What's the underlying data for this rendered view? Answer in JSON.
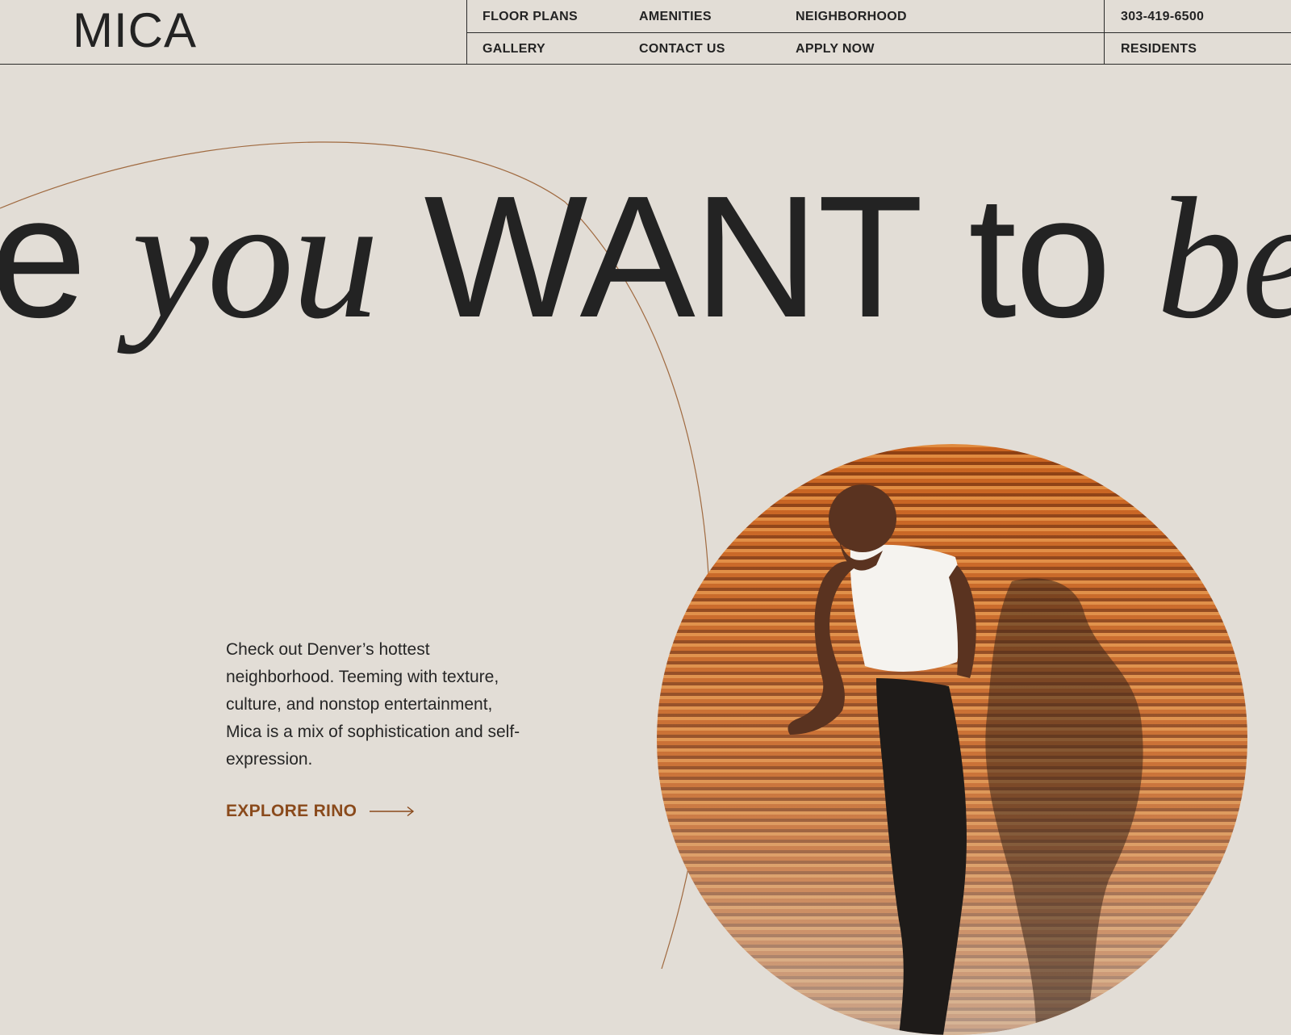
{
  "brand": {
    "logo": "MICA"
  },
  "nav": {
    "row1": [
      "FLOOR PLANS",
      "AMENITIES",
      "NEIGHBORHOOD"
    ],
    "row2": [
      "GALLERY",
      "CONTACT US",
      "APPLY NOW"
    ],
    "phone": "303-419-6500",
    "residents": "RESIDENTS"
  },
  "hero": {
    "title_parts": [
      "e",
      "you",
      "WANT",
      "to",
      "be"
    ],
    "intro": "Check out Denver’s hottest neighborhood. Teeming with texture, culture, and nonstop entertainment, Mica is a mix of sophistication and self-expression.",
    "cta_label": "EXPLORE RINO",
    "cta_icon": "arrow-right-icon"
  },
  "colors": {
    "background": "#e2ddd6",
    "text": "#232323",
    "accent": "#8a4a1c",
    "arc": "#a06a40",
    "rust": "#c8621e"
  }
}
